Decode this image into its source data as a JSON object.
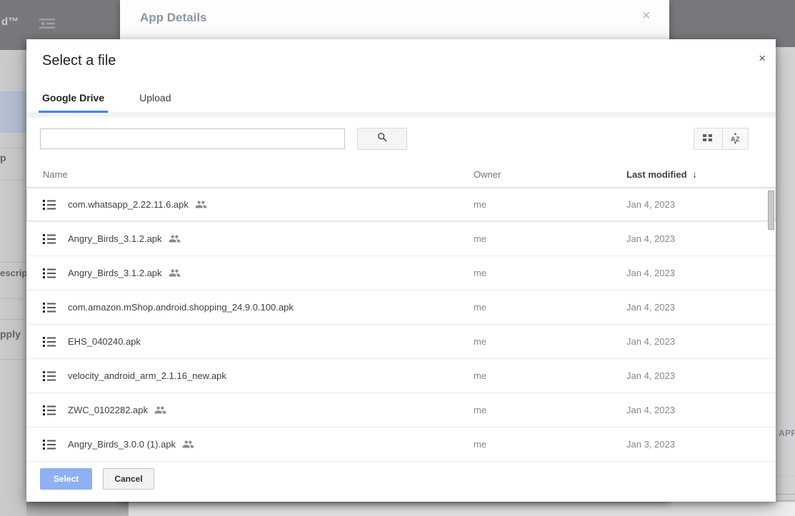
{
  "background": {
    "top_bar": {
      "logo_fragment": "d™",
      "menu_icon": "indent-decrease-icon"
    },
    "left_fragments": {
      "frag1": "p",
      "frag2": "escript",
      "frag3": "pply"
    },
    "right_fragment": "APP"
  },
  "app_details_dialog": {
    "title": "App Details"
  },
  "file_picker": {
    "title": "Select a file",
    "tabs": [
      {
        "label": "Google Drive",
        "active": true
      },
      {
        "label": "Upload",
        "active": false
      }
    ],
    "search": {
      "value": "",
      "placeholder": ""
    },
    "table": {
      "columns": [
        "Name",
        "Owner",
        "Last modified"
      ],
      "sorted_by": "Last modified",
      "sort_direction": "descending",
      "rows": [
        {
          "name": "com.whatsapp_2.22.11.6.apk",
          "shared": true,
          "owner": "me",
          "modified": "Jan 4, 2023",
          "selected": true
        },
        {
          "name": "Angry_Birds_3.1.2.apk",
          "shared": true,
          "owner": "me",
          "modified": "Jan 4, 2023"
        },
        {
          "name": "Angry_Birds_3.1.2.apk",
          "shared": true,
          "owner": "me",
          "modified": "Jan 4, 2023"
        },
        {
          "name": "com.amazon.mShop.android.shopping_24.9.0.100.apk",
          "shared": false,
          "owner": "me",
          "modified": "Jan 4, 2023"
        },
        {
          "name": "EHS_040240.apk",
          "shared": false,
          "owner": "me",
          "modified": "Jan 4, 2023"
        },
        {
          "name": "velocity_android_arm_2.1.16_new.apk",
          "shared": false,
          "owner": "me",
          "modified": "Jan 4, 2023"
        },
        {
          "name": "ZWC_0102282.apk",
          "shared": true,
          "owner": "me",
          "modified": "Jan 4, 2023"
        },
        {
          "name": "Angry_Birds_3.0.0 (1).apk",
          "shared": true,
          "owner": "me",
          "modified": "Jan 3, 2023"
        }
      ]
    },
    "buttons": {
      "select": "Select",
      "cancel": "Cancel"
    }
  },
  "icons": {
    "close": "×",
    "sort_desc_arrow": "↓",
    "sort_az_letters": "AZ",
    "triangle_up": "▲",
    "triangle_down": "▼"
  },
  "colors": {
    "accent_blue": "#4285f4",
    "select_button_blue": "#8fb0f2",
    "selected_row_outline": "#d7e1f8"
  }
}
